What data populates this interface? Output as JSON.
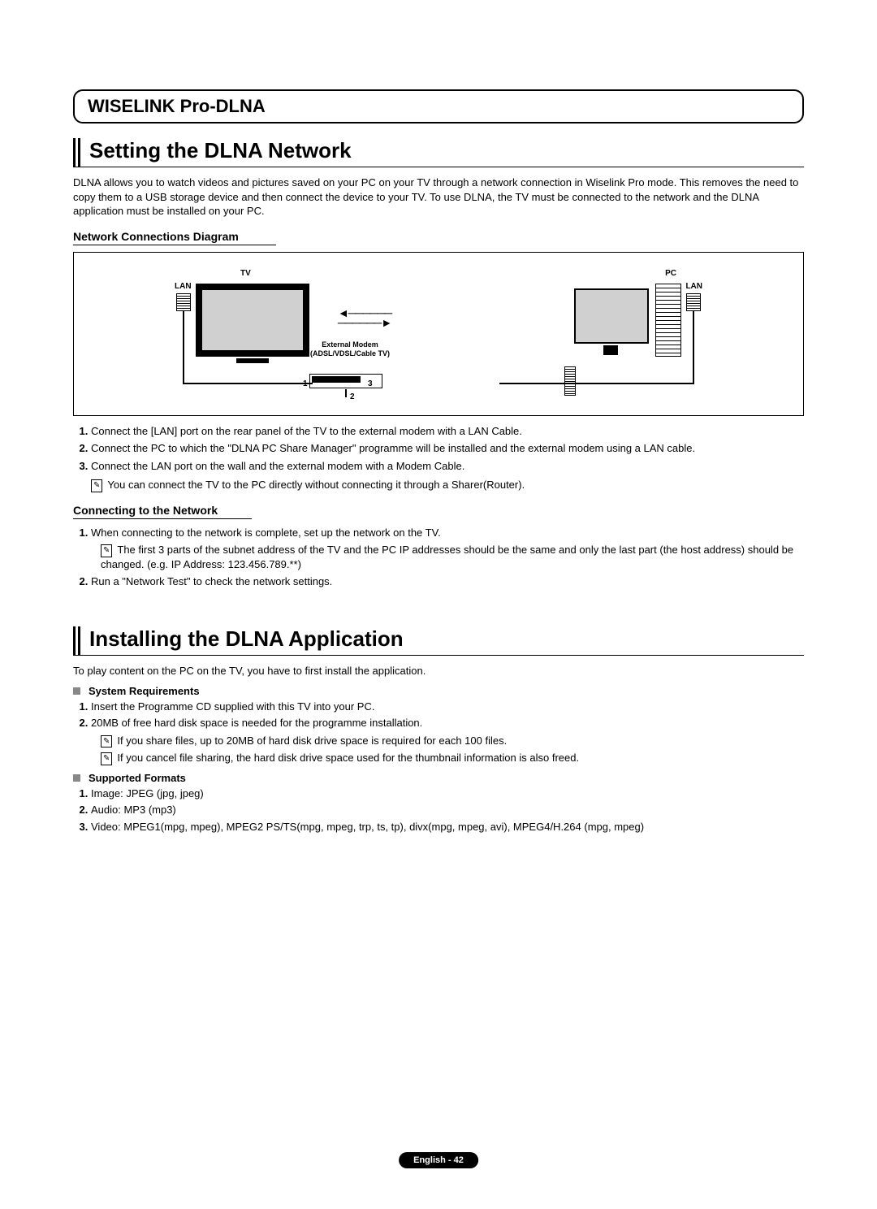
{
  "page_header": "WISELINK Pro-DLNA",
  "section1": {
    "title": "Setting the DLNA Network",
    "intro": "DLNA allows you to watch videos and pictures saved on your PC on your TV through a network connection in Wiselink Pro mode. This removes the need to copy them to a USB storage device and then connect the device to your TV. To use DLNA, the TV must be connected to the network and the DLNA application must be installed on your PC.",
    "diagram_heading": "Network Connections Diagram",
    "diagram": {
      "tv_label": "TV",
      "pc_label": "PC",
      "lan_label_left": "LAN",
      "lan_label_right": "LAN",
      "modem_label": "External Modem\n(ADSL/VDSL/Cable TV)",
      "n1": "1",
      "n2": "2",
      "n3": "3"
    },
    "steps": [
      "Connect the [LAN] port on the rear panel of the TV to the external modem with a LAN Cable.",
      "Connect the PC to which the \"DLNA PC Share Manager\" programme will be installed and the external modem using a LAN cable.",
      "Connect the LAN port on the wall and the external modem with a Modem Cable."
    ],
    "note1": "You can connect the TV to the PC directly without connecting it through a Sharer(Router).",
    "connect_heading": "Connecting to the Network",
    "connect_steps": {
      "s1": "When connecting to the network is complete, set up the network on the TV.",
      "s1_note": "The first 3 parts of the subnet address of the TV and the PC IP addresses should be the same and only the last part (the host address) should be changed. (e.g. IP Address: 123.456.789.**)",
      "s2": "Run a \"Network Test\" to check the network settings."
    }
  },
  "section2": {
    "title": "Installing the DLNA Application",
    "intro": "To play content on the PC on the TV, you have to first install the application.",
    "sysreq_heading": "System Requirements",
    "sysreq_steps": [
      "Insert the Programme CD supplied with this TV into your PC.",
      "20MB of free hard disk space is needed for the programme installation."
    ],
    "sysreq_notes": [
      "If you share files, up to 20MB of hard disk drive space is required for each 100 files.",
      "If you cancel file sharing, the hard disk drive space used for the thumbnail information is also freed."
    ],
    "formats_heading": "Supported Formats",
    "formats": [
      "Image: JPEG (jpg, jpeg)",
      "Audio: MP3 (mp3)",
      "Video: MPEG1(mpg, mpeg), MPEG2 PS/TS(mpg, mpeg, trp, ts, tp), divx(mpg, mpeg, avi), MPEG4/H.264 (mpg, mpeg)"
    ]
  },
  "footer": "English - 42"
}
